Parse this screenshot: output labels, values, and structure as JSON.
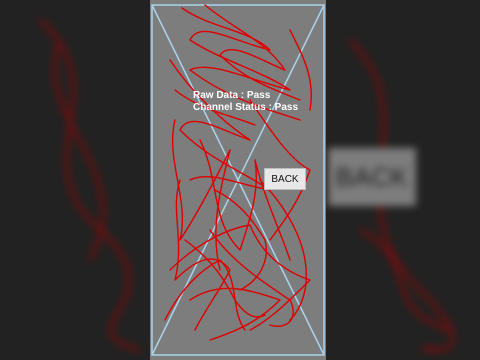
{
  "test_screen": {
    "raw_data_status": "Raw Data : Pass",
    "channel_status": "Channel Status : Pass",
    "back_label": "BACK"
  },
  "background": {
    "back_label": "BACK"
  },
  "colors": {
    "backdrop": "#222222",
    "screen": "#7d7d7d",
    "scribble": "#e00000",
    "cross_lines": "#a9d3ec",
    "button": "#e8e8e8"
  }
}
